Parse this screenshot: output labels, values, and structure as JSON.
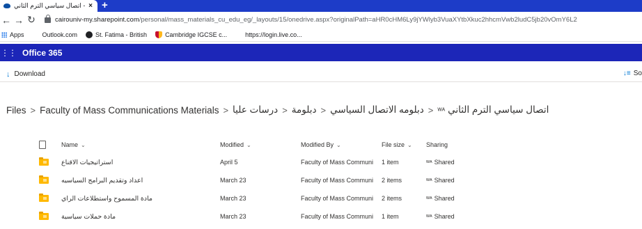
{
  "browser": {
    "tab_title": "اتصال سياسي الترم الثاني - OneDrive",
    "tab_close": "×",
    "new_tab": "+",
    "url_host": "cairouniv-my.sharepoint.com",
    "url_path": "/personal/mass_materials_cu_edu_eg/_layouts/15/onedrive.aspx?originalPath=aHR0cHM6Ly9jYWlyb3VuaXYtbXkuc2hhcmVwb2ludC5jb20vOmY6L2"
  },
  "bookmarks": [
    {
      "label": "Apps",
      "icon": "apps-grid-icon"
    },
    {
      "label": "Outlook.com",
      "icon": "microsoft-icon"
    },
    {
      "label": "St. Fatima - British",
      "icon": "st-fatima-icon"
    },
    {
      "label": "Cambridge IGCSE c...",
      "icon": "cambridge-icon"
    },
    {
      "label": "https://login.live.co...",
      "icon": "microsoft-icon"
    }
  ],
  "suite": {
    "title": "Office 365"
  },
  "command_bar": {
    "download": "Download",
    "sort": "So"
  },
  "breadcrumb": [
    "Files",
    "Faculty of Mass Communications Materials",
    "درسات عليا",
    "دبلومة",
    "دبلومه الاتصال السياسي",
    "اتصال سياسي الترم الثاني"
  ],
  "list": {
    "columns": {
      "name": "Name",
      "modified": "Modified",
      "modified_by": "Modified By",
      "file_size": "File size",
      "sharing": "Sharing"
    },
    "rows": [
      {
        "name": "استراتيجيات الاقناع",
        "modified": "April 5",
        "modified_by": "Faculty of Mass Communi",
        "size": "1 item",
        "sharing": "Shared"
      },
      {
        "name": "اعداد وتقديم البرامج السياسيه",
        "modified": "March 23",
        "modified_by": "Faculty of Mass Communi",
        "size": "2 items",
        "sharing": "Shared"
      },
      {
        "name": "مادة المسموح واستطلاعات الراي",
        "modified": "March 23",
        "modified_by": "Faculty of Mass Communi",
        "size": "2 items",
        "sharing": "Shared"
      },
      {
        "name": "مادة حملات سياسية",
        "modified": "March 23",
        "modified_by": "Faculty of Mass Communi",
        "size": "1 item",
        "sharing": "Shared"
      }
    ]
  },
  "colors": {
    "tabstrip": "#1d3cc8",
    "suitebar": "#1c26b8",
    "accent": "#0078d4",
    "folder": "#ffb900"
  }
}
